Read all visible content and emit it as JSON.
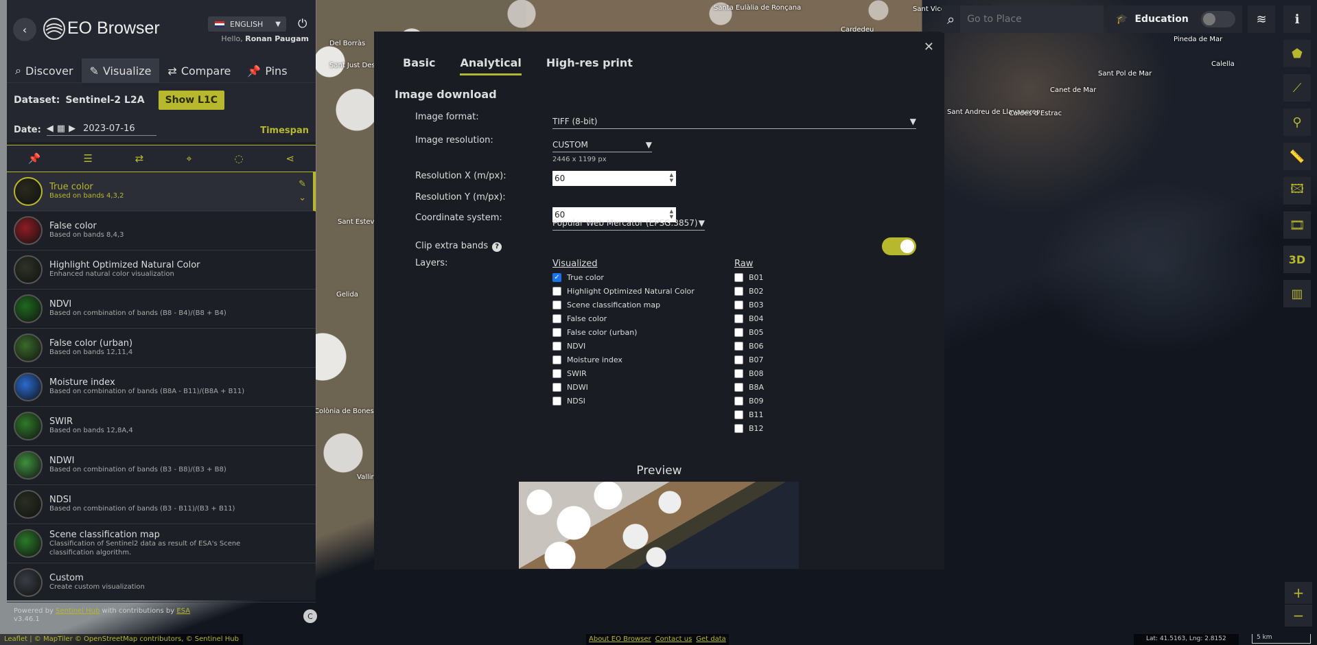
{
  "map_labels": [
    "Santa Eulàlia de Ronçana",
    "Sant Vicenç de Montalt",
    "Cardedeu",
    "Pineda de Mar",
    "Calella",
    "Sant Pol de Mar",
    "Canet de Mar",
    "Sant Andreu de Llavaneres",
    "Caldes d'Estrac",
    "Del Borràs",
    "Sant Just Desvern",
    "Gelida",
    "Sant Esteve Sesrovires",
    "Colònia de Bonesvalls",
    "Vallirana"
  ],
  "sidebar": {
    "app_title": "EO Browser",
    "language": "ENGLISH",
    "hello_prefix": "Hello,",
    "user": "Ronan Paugam",
    "tabs": [
      {
        "label": "Discover",
        "icon": "search-icon"
      },
      {
        "label": "Visualize",
        "icon": "brush-icon"
      },
      {
        "label": "Compare",
        "icon": "compare-icon"
      },
      {
        "label": "Pins",
        "icon": "pin-icon"
      }
    ],
    "dataset_label": "Dataset:",
    "dataset_name": "Sentinel-2 L2A",
    "show_l1c": "Show L1C",
    "date_label": "Date:",
    "date_value": "2023-07-16",
    "timespan": "Timespan",
    "layers": [
      {
        "title": "True color",
        "subtitle": "Based on bands 4,3,2",
        "thumb": "#2a2a1c"
      },
      {
        "title": "False color",
        "subtitle": "Based on bands 8,4,3",
        "thumb": "#8f1c24"
      },
      {
        "title": "Highlight Optimized Natural Color",
        "subtitle": "Enhanced natural color visualization",
        "thumb": "#2e3326"
      },
      {
        "title": "NDVI",
        "subtitle": "Based on combination of bands (B8 - B4)/(B8 + B4)",
        "thumb": "#1f6a1f"
      },
      {
        "title": "False color (urban)",
        "subtitle": "Based on bands 12,11,4",
        "thumb": "#3a6a2a"
      },
      {
        "title": "Moisture index",
        "subtitle": "Based on combination of bands (B8A - B11)/(B8A + B11)",
        "thumb": "#2a6ad0"
      },
      {
        "title": "SWIR",
        "subtitle": "Based on bands 12,8A,4",
        "thumb": "#2f7a2a"
      },
      {
        "title": "NDWI",
        "subtitle": "Based on combination of bands (B3 - B8)/(B3 + B8)",
        "thumb": "#3f8f3f"
      },
      {
        "title": "NDSI",
        "subtitle": "Based on combination of bands (B3 - B11)/(B3 + B11)",
        "thumb": "#2a2e22"
      },
      {
        "title": "Scene classification map",
        "subtitle": "Classification of Sentinel2 data as result of ESA's Scene classification algorithm.",
        "thumb": "#2a7a2a"
      },
      {
        "title": "Custom",
        "subtitle": "Create custom visualization",
        "thumb": "#3a3d45"
      }
    ],
    "powered_prefix": "Powered by",
    "powered_link1": "Sentinel Hub",
    "powered_mid": "with contributions by",
    "powered_link2": "ESA",
    "version": "v3.46.1"
  },
  "modal": {
    "tabs": [
      "Basic",
      "Analytical",
      "High-res print"
    ],
    "section_title": "Image download",
    "image_format_label": "Image format:",
    "image_format_value": "TIFF (8-bit)",
    "image_resolution_label": "Image resolution:",
    "image_resolution_value": "CUSTOM",
    "image_resolution_px": "2446 x 1199 px",
    "res_x_label": "Resolution X (m/px):",
    "res_x_value": "60",
    "res_y_label": "Resolution Y (m/px):",
    "res_y_value": "60",
    "crs_label": "Coordinate system:",
    "crs_value": "Popular Web Mercator (EPSG:3857)",
    "clip_label": "Clip extra bands",
    "clip_enabled": true,
    "layers_label": "Layers:",
    "visualized_header": "Visualized",
    "raw_header": "Raw",
    "visualized": [
      {
        "label": "True color",
        "checked": true
      },
      {
        "label": "Highlight Optimized Natural Color",
        "checked": false
      },
      {
        "label": "Scene classification map",
        "checked": false
      },
      {
        "label": "False color",
        "checked": false
      },
      {
        "label": "False color (urban)",
        "checked": false
      },
      {
        "label": "NDVI",
        "checked": false
      },
      {
        "label": "Moisture index",
        "checked": false
      },
      {
        "label": "SWIR",
        "checked": false
      },
      {
        "label": "NDWI",
        "checked": false
      },
      {
        "label": "NDSI",
        "checked": false
      }
    ],
    "raw": [
      "B01",
      "B02",
      "B03",
      "B04",
      "B05",
      "B06",
      "B07",
      "B08",
      "B8A",
      "B09",
      "B11",
      "B12"
    ],
    "preview_title": "Preview"
  },
  "topbar": {
    "search_placeholder": "Go to Place",
    "education_label": "Education"
  },
  "right_tools": [
    "info-icon",
    "layers-icon",
    "polygon-icon",
    "line-icon",
    "marker-icon",
    "ruler-icon",
    "image-download-icon",
    "timelapse-icon",
    "3d-icon",
    "histogram-icon"
  ],
  "footer": {
    "attribution": "Leaflet | © MapTiler © OpenStreetMap contributors, © Sentinel Hub",
    "links": [
      "About EO Browser",
      "Contact us",
      "Get data"
    ],
    "latlng": "Lat: 41.5163, Lng: 2.8152",
    "scale": "5 km"
  }
}
